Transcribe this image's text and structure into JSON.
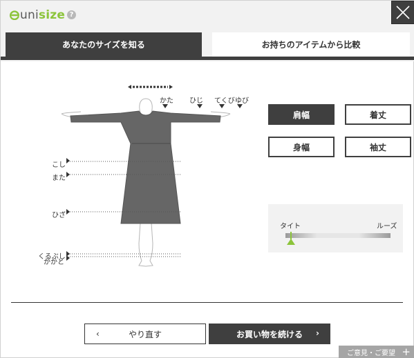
{
  "header": {
    "logo_text_1": "uni",
    "logo_text_2": "size",
    "help_symbol": "?"
  },
  "tabs": [
    {
      "label": "あなたのサイズを知る",
      "active": true
    },
    {
      "label": "お持ちのアイテムから比較",
      "active": false
    }
  ],
  "figure": {
    "labels": {
      "kata": "かた",
      "hiji": "ひじ",
      "tekubi": "てくび",
      "yubi": "ゆび",
      "koshi": "こし",
      "mata": "また",
      "hiza": "ひざ",
      "kurubushi": "くるぶし",
      "kakato": "かかと"
    }
  },
  "measurements": [
    {
      "label": "肩幅",
      "active": true
    },
    {
      "label": "着丈",
      "active": false
    },
    {
      "label": "身幅",
      "active": false
    },
    {
      "label": "袖丈",
      "active": false
    }
  ],
  "fit": {
    "left_label": "タイト",
    "right_label": "ルーズ",
    "position": 0.05,
    "accent": "#8cc43b"
  },
  "actions": {
    "redo_label": "やり直す",
    "continue_label": "お買い物を続ける",
    "chevron_left": "‹",
    "chevron_right": "›"
  },
  "feedback": {
    "label": "ご意見・ご要望",
    "plus": "+"
  }
}
